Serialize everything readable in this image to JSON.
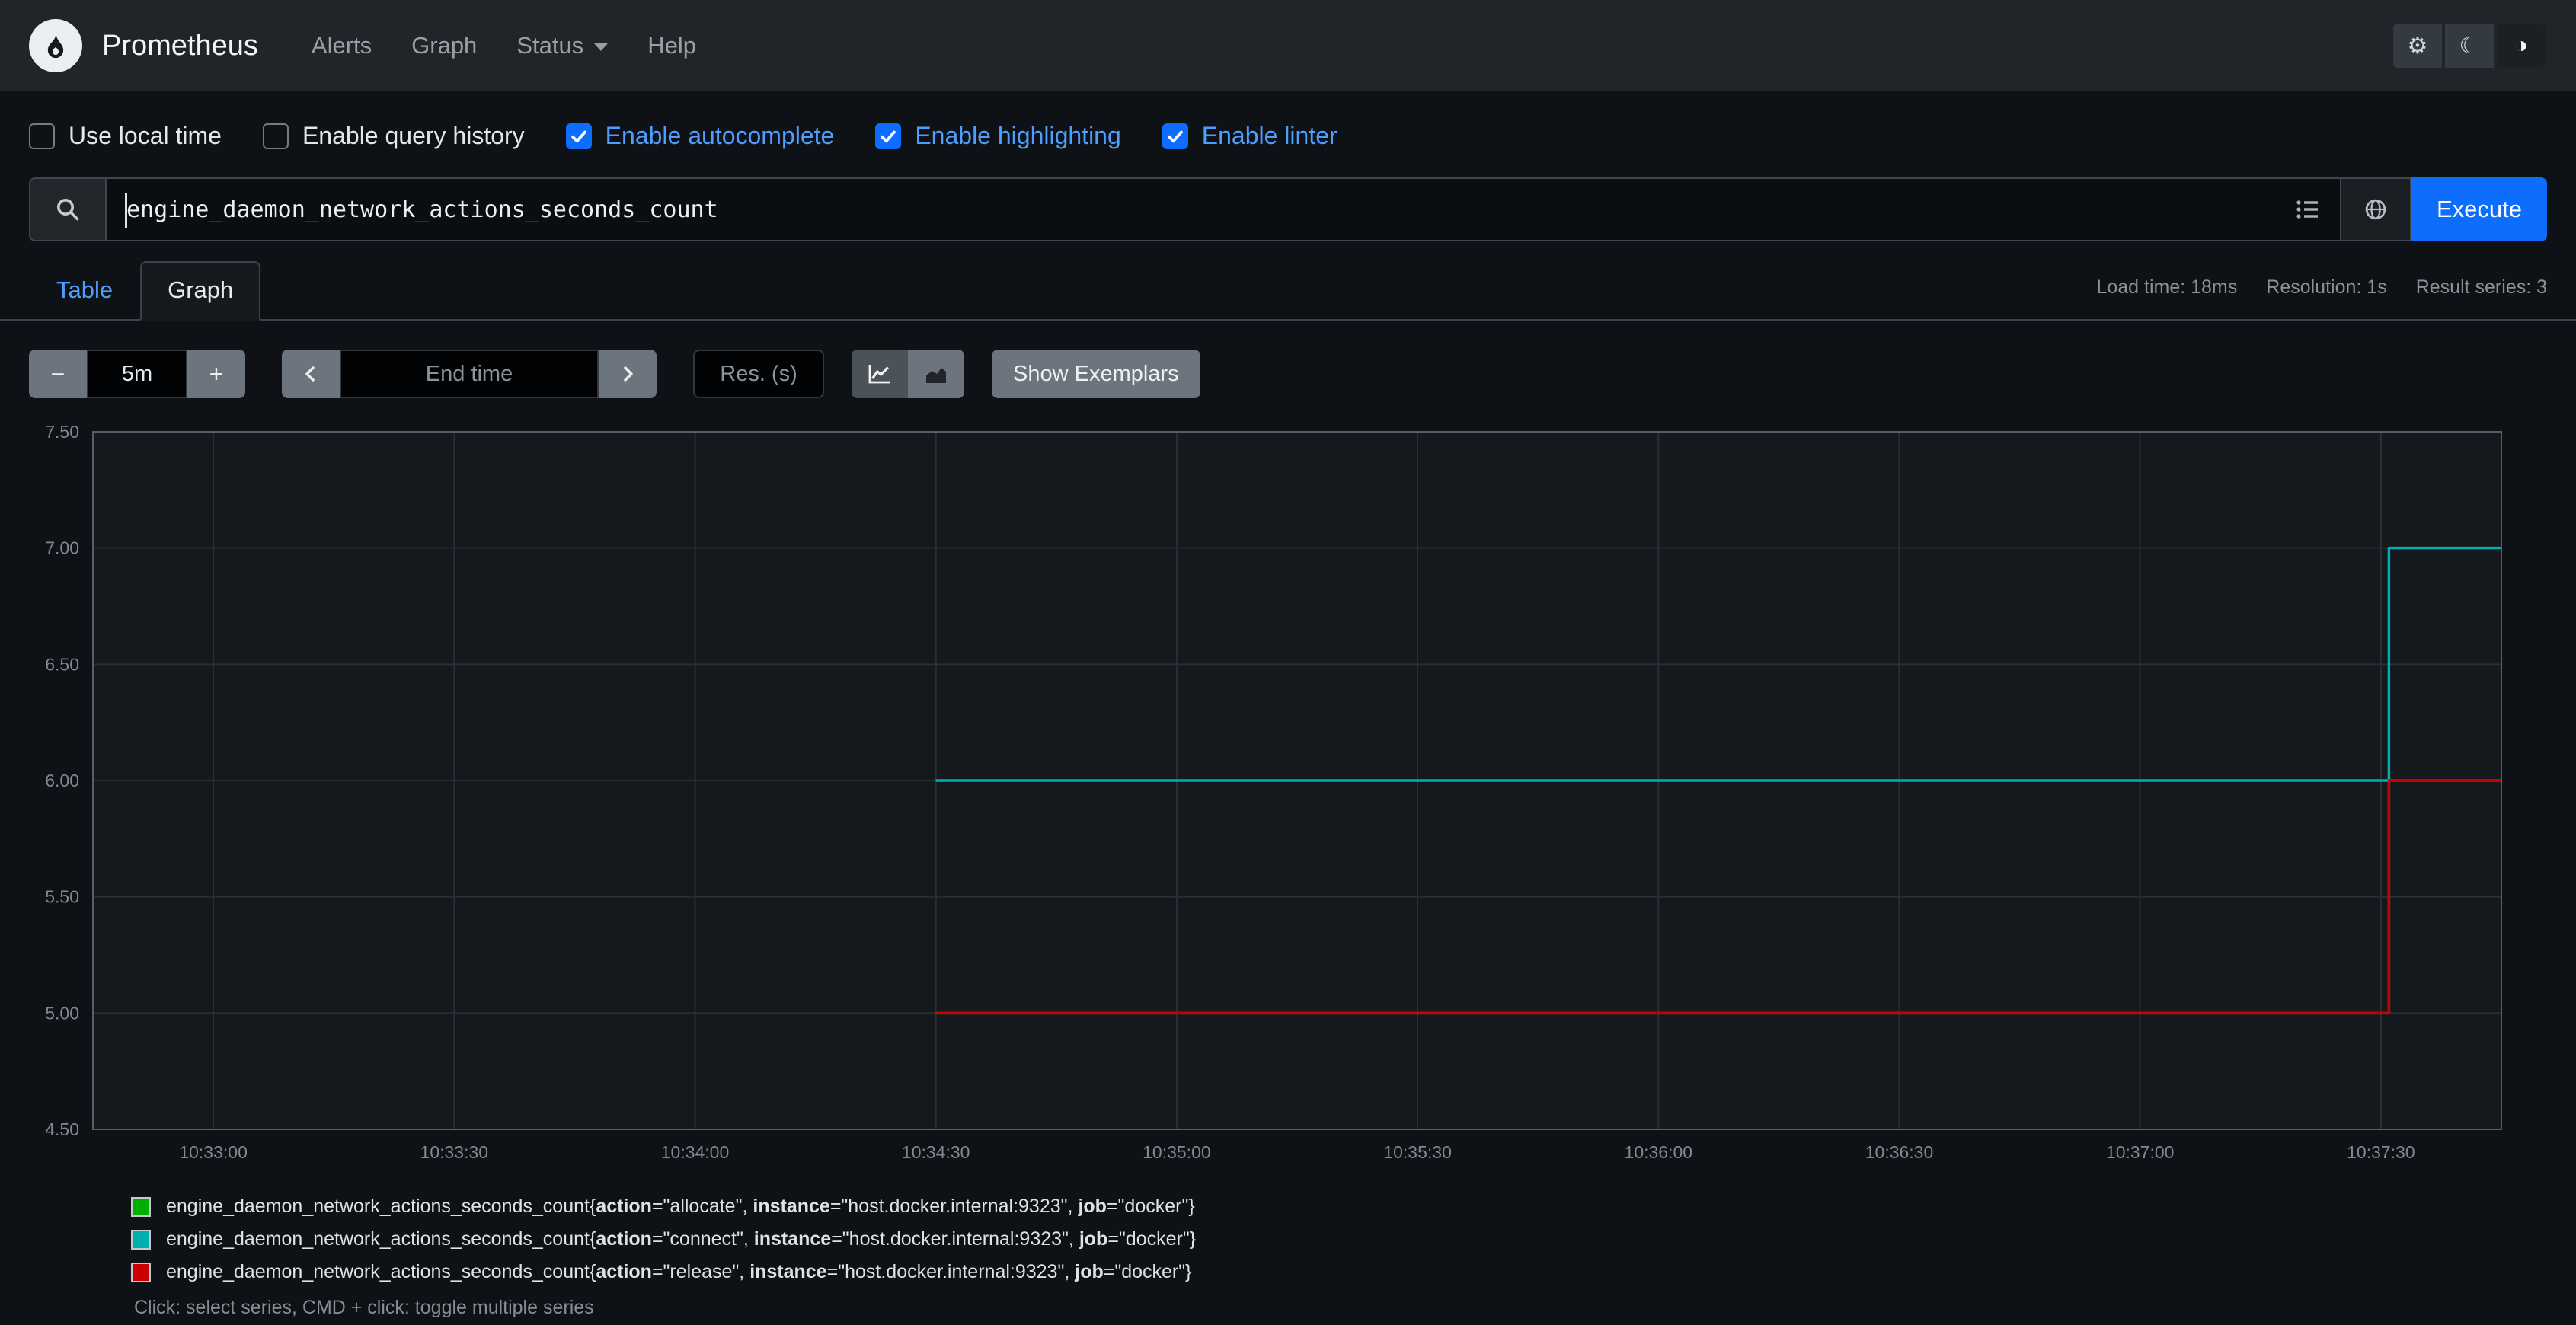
{
  "navbar": {
    "brand": "Prometheus",
    "links": [
      {
        "label": "Alerts",
        "dropdown": false
      },
      {
        "label": "Graph",
        "dropdown": false
      },
      {
        "label": "Status",
        "dropdown": true
      },
      {
        "label": "Help",
        "dropdown": false
      }
    ],
    "theme_icons": [
      {
        "name": "gear-icon",
        "glyph": "⚙"
      },
      {
        "name": "moon-icon",
        "glyph": "☾"
      },
      {
        "name": "circle-half-icon",
        "glyph": "◑"
      }
    ]
  },
  "options": [
    {
      "label": "Use local time",
      "checked": false
    },
    {
      "label": "Enable query history",
      "checked": false
    },
    {
      "label": "Enable autocomplete",
      "checked": true
    },
    {
      "label": "Enable highlighting",
      "checked": true
    },
    {
      "label": "Enable linter",
      "checked": true
    }
  ],
  "query_bar": {
    "value": "engine_daemon_network_actions_seconds_count",
    "execute_label": "Execute"
  },
  "tabs": [
    {
      "label": "Table",
      "active": false
    },
    {
      "label": "Graph",
      "active": true
    }
  ],
  "stats": [
    "Load time: 18ms",
    "Resolution: 1s",
    "Result series: 3"
  ],
  "graph_controls": {
    "decrease_range": "−",
    "range_value": "5m",
    "increase_range": "+",
    "end_time_placeholder": "End time",
    "resolution_placeholder": "Res. (s)",
    "show_exemplars": "Show Exemplars"
  },
  "chart_data": {
    "type": "line",
    "title": "",
    "xlabel": "",
    "ylabel": "",
    "grid": true,
    "legend_position": "bottom",
    "x_axis": {
      "domain_seconds": [
        0,
        300
      ],
      "window_start": "10:32:45",
      "window_end": "10:37:45",
      "ticks": [
        {
          "s": 15,
          "label": "10:33:00"
        },
        {
          "s": 45,
          "label": "10:33:30"
        },
        {
          "s": 75,
          "label": "10:34:00"
        },
        {
          "s": 105,
          "label": "10:34:30"
        },
        {
          "s": 135,
          "label": "10:35:00"
        },
        {
          "s": 165,
          "label": "10:35:30"
        },
        {
          "s": 195,
          "label": "10:36:00"
        },
        {
          "s": 225,
          "label": "10:36:30"
        },
        {
          "s": 255,
          "label": "10:37:00"
        },
        {
          "s": 285,
          "label": "10:37:30"
        }
      ]
    },
    "y_axis": {
      "lim": [
        4.5,
        7.5
      ],
      "ticks": [
        7.5,
        7.0,
        6.5,
        6.0,
        5.5,
        5.0,
        4.5
      ],
      "decimals": 2
    },
    "series": [
      {
        "name": "engine_daemon_network_actions_seconds_count{action=\"allocate\", instance=\"host.docker.internal:9323\", job=\"docker\"}",
        "color": "#00b000",
        "points": [
          [
            105,
            5.0
          ],
          [
            286,
            5.0
          ],
          [
            286,
            6.0
          ],
          [
            300,
            6.0
          ]
        ]
      },
      {
        "name": "engine_daemon_network_actions_seconds_count{action=\"connect\", instance=\"host.docker.internal:9323\", job=\"docker\"}",
        "color": "#00b0b0",
        "points": [
          [
            105,
            6.0
          ],
          [
            286,
            6.0
          ],
          [
            286,
            7.0
          ],
          [
            300,
            7.0
          ]
        ]
      },
      {
        "name": "engine_daemon_network_actions_seconds_count{action=\"release\", instance=\"host.docker.internal:9323\", job=\"docker\"}",
        "color": "#cc0000",
        "points": [
          [
            105,
            5.0
          ],
          [
            286,
            5.0
          ],
          [
            286,
            6.0
          ],
          [
            300,
            6.0
          ]
        ]
      }
    ],
    "colors": {
      "plot_bg": "#15181c",
      "grid": "#2a2f35",
      "border": "#585e65",
      "tick_text": "#82888f"
    }
  },
  "legend": {
    "items": [
      {
        "color": "#00b000",
        "metric": "engine_daemon_network_actions_seconds_count",
        "labels": [
          [
            "action",
            "allocate"
          ],
          [
            "instance",
            "host.docker.internal:9323"
          ],
          [
            "job",
            "docker"
          ]
        ]
      },
      {
        "color": "#00b0b0",
        "metric": "engine_daemon_network_actions_seconds_count",
        "labels": [
          [
            "action",
            "connect"
          ],
          [
            "instance",
            "host.docker.internal:9323"
          ],
          [
            "job",
            "docker"
          ]
        ]
      },
      {
        "color": "#cc0000",
        "metric": "engine_daemon_network_actions_seconds_count",
        "labels": [
          [
            "action",
            "release"
          ],
          [
            "instance",
            "host.docker.internal:9323"
          ],
          [
            "job",
            "docker"
          ]
        ]
      }
    ]
  },
  "footer_hint": "Click: select series, CMD + click: toggle multiple series",
  "accent_colors": {
    "primary_blue": "#0d6efd",
    "link_blue": "#4d9fff"
  }
}
